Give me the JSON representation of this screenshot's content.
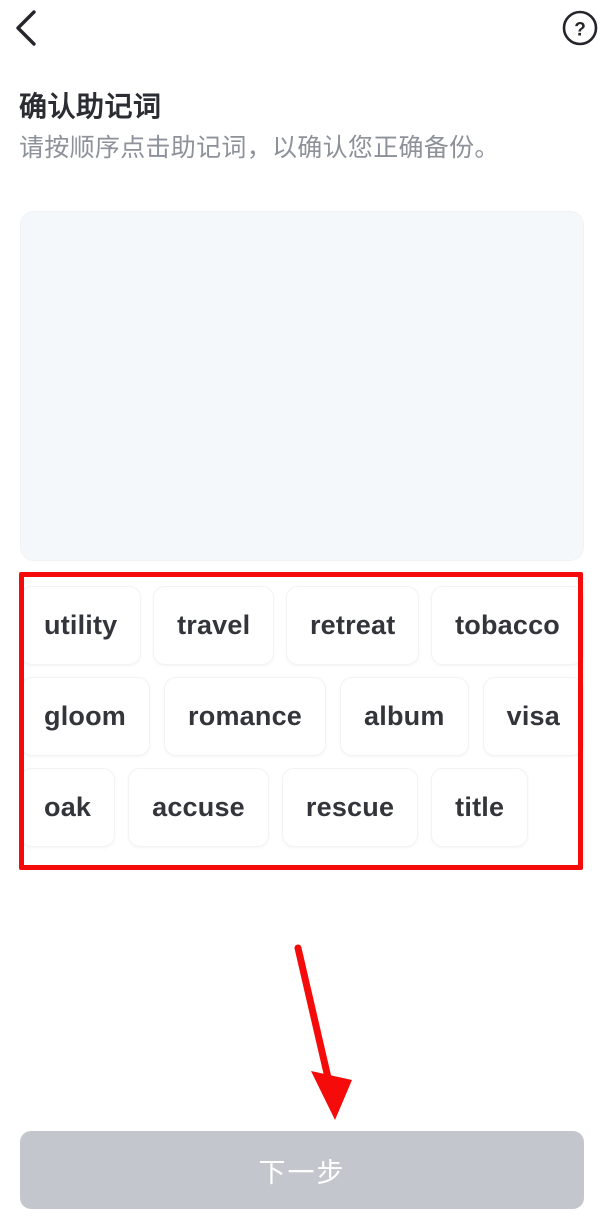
{
  "app": {
    "background_color": "#ffffff"
  },
  "topbar": {
    "back_icon": "chevron-left-icon",
    "help_icon": "question-mark-circle-icon",
    "help_glyph": "?"
  },
  "header": {
    "title": "确认助记词",
    "subtitle": "请按顺序点击助记词，以确认您正确备份。"
  },
  "answer_panel": {
    "selected_words": [],
    "placeholder": "",
    "background_color": "#f5f8fb"
  },
  "word_bank": {
    "rows": [
      [
        "utility",
        "travel",
        "retreat",
        "tobacco"
      ],
      [
        "gloom",
        "romance",
        "album",
        "visa"
      ],
      [
        "oak",
        "accuse",
        "rescue",
        "title"
      ]
    ],
    "words": [
      "utility",
      "travel",
      "retreat",
      "tobacco",
      "gloom",
      "romance",
      "album",
      "visa",
      "oak",
      "accuse",
      "rescue",
      "title"
    ]
  },
  "footer": {
    "next_label": "下一步",
    "next_enabled": false,
    "disabled_color": "#c3c7cd"
  },
  "annotations": {
    "highlight_color": "#f60b0b",
    "box_target": "word-bank",
    "arrow_target": "next-button"
  }
}
